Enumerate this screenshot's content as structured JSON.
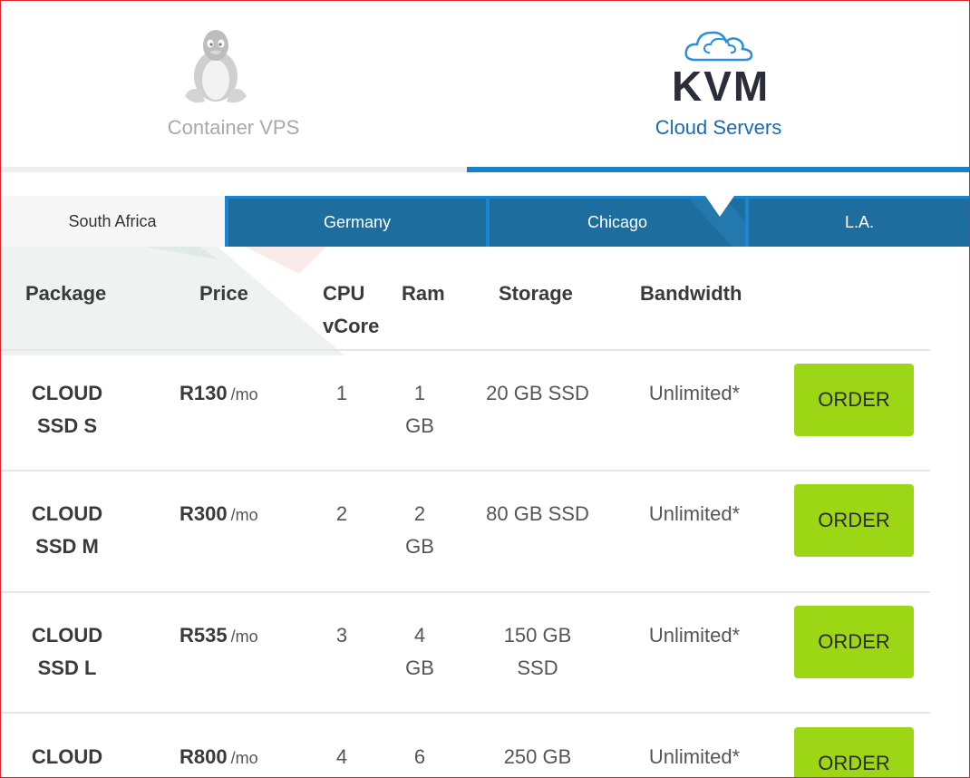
{
  "product_tabs": [
    {
      "label": "Container VPS",
      "icon": "linux-penguin-icon",
      "active": false
    },
    {
      "label": "Cloud Servers",
      "logo_text": "KVM",
      "icon": "cloud-icon",
      "active": true
    }
  ],
  "location_tabs": [
    {
      "label": "South Africa",
      "active": true
    },
    {
      "label": "Germany",
      "active": false
    },
    {
      "label": "Chicago",
      "active": false
    },
    {
      "label": "L.A.",
      "active": false
    }
  ],
  "table": {
    "headers": {
      "package": "Package",
      "price": "Price",
      "cpu_line1": "CPU",
      "cpu_line2": "vCore",
      "ram": "Ram",
      "storage": "Storage",
      "bandwidth": "Bandwidth"
    },
    "rows": [
      {
        "pkg1": "CLOUD",
        "pkg2": "SSD S",
        "price": "R130",
        "per": "/mo",
        "cpu": "1",
        "ram1": "1",
        "ram2": "GB",
        "storage1": "20 GB SSD",
        "storage2": "",
        "bandwidth": "Unlimited*",
        "order": "ORDER"
      },
      {
        "pkg1": "CLOUD",
        "pkg2": "SSD M",
        "price": "R300",
        "per": "/mo",
        "cpu": "2",
        "ram1": "2",
        "ram2": "GB",
        "storage1": "80 GB SSD",
        "storage2": "",
        "bandwidth": "Unlimited*",
        "order": "ORDER"
      },
      {
        "pkg1": "CLOUD",
        "pkg2": "SSD L",
        "price": "R535",
        "per": "/mo",
        "cpu": "3",
        "ram1": "4",
        "ram2": "GB",
        "storage1": "150 GB",
        "storage2": "SSD",
        "bandwidth": "Unlimited*",
        "order": "ORDER"
      },
      {
        "pkg1": "CLOUD",
        "pkg2": "",
        "price": "R800",
        "per": "/mo",
        "cpu": "4",
        "ram1": "6",
        "ram2": "",
        "storage1": "250 GB",
        "storage2": "",
        "bandwidth": "Unlimited*",
        "order": "ORDER"
      }
    ]
  },
  "colors": {
    "accent_blue": "#1a81c5",
    "tab_blue": "#1d6e9e",
    "order_green": "#9dd614",
    "frame_red": "#d9252b"
  }
}
